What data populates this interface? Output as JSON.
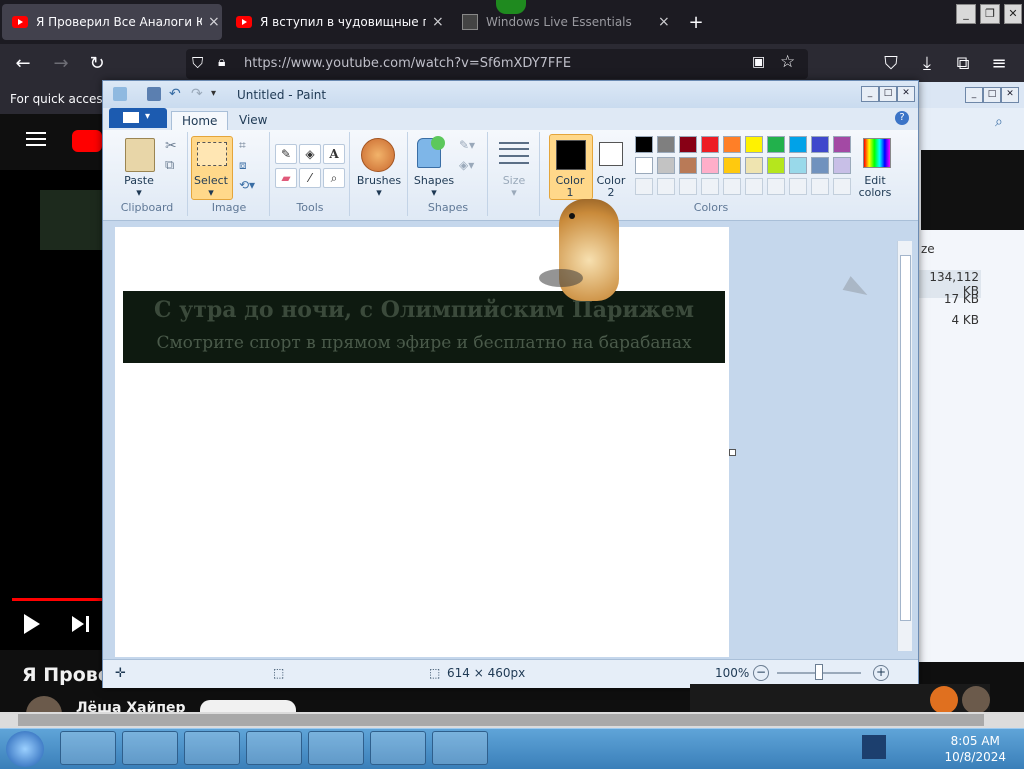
{
  "browser": {
    "tabs": [
      {
        "title": "Я Проверил Все Аналоги Ютуб",
        "close": "×"
      },
      {
        "title": "Я вступил в чудовищные груп",
        "close": "×"
      },
      {
        "title": "Windows Live Essentials",
        "close": "×"
      }
    ],
    "new_tab": "+",
    "url": "https://www.youtube.com/watch?v=Sf6mXDY7FFE",
    "bookmarks_hint": "For quick access, place your bookmarks here"
  },
  "youtube": {
    "video_title": "Я Проверил Все Аналоги Ютуб",
    "channel": "Лёша Хайпер"
  },
  "explorer": {
    "column_partial": "ze",
    "sizes": [
      "134,112 KB",
      "17 KB",
      "4 KB"
    ]
  },
  "paint": {
    "title": "Untitled - Paint",
    "tabs": {
      "home": "Home",
      "view": "View"
    },
    "groups": {
      "clipboard": "Clipboard",
      "image": "Image",
      "tools": "Tools",
      "shapes": "Shapes",
      "colors": "Colors"
    },
    "buttons": {
      "paste": "Paste",
      "select": "Select",
      "brushes": "Brushes",
      "shapes": "Shapes",
      "size": "Size",
      "color1_a": "Color",
      "color1_b": "1",
      "color2_a": "Color",
      "color2_b": "2",
      "edit_colors_a": "Edit",
      "edit_colors_b": "colors"
    },
    "color1": "#000000",
    "color2": "#ffffff",
    "palette": [
      "#000000",
      "#7f7f7f",
      "#880015",
      "#ed1c24",
      "#ff7f27",
      "#fff200",
      "#22b14c",
      "#00a2e8",
      "#3f48cc",
      "#a349a4",
      "#ffffff",
      "#c3c3c3",
      "#b97a57",
      "#ffaec9",
      "#ffc90e",
      "#efe4b0",
      "#b5e61d",
      "#99d9ea",
      "#7092be",
      "#c8bfe7"
    ],
    "canvas_banner": {
      "line1": "С утра до ночи, с Олимпийским Парижем",
      "line2": "Смотрите спорт в прямом эфире и бесплатно на барабанах"
    },
    "status": {
      "dimensions": "614 × 460px",
      "zoom": "100%"
    }
  },
  "taskbar": {
    "time": "8:05 AM",
    "date": "10/8/2024"
  }
}
